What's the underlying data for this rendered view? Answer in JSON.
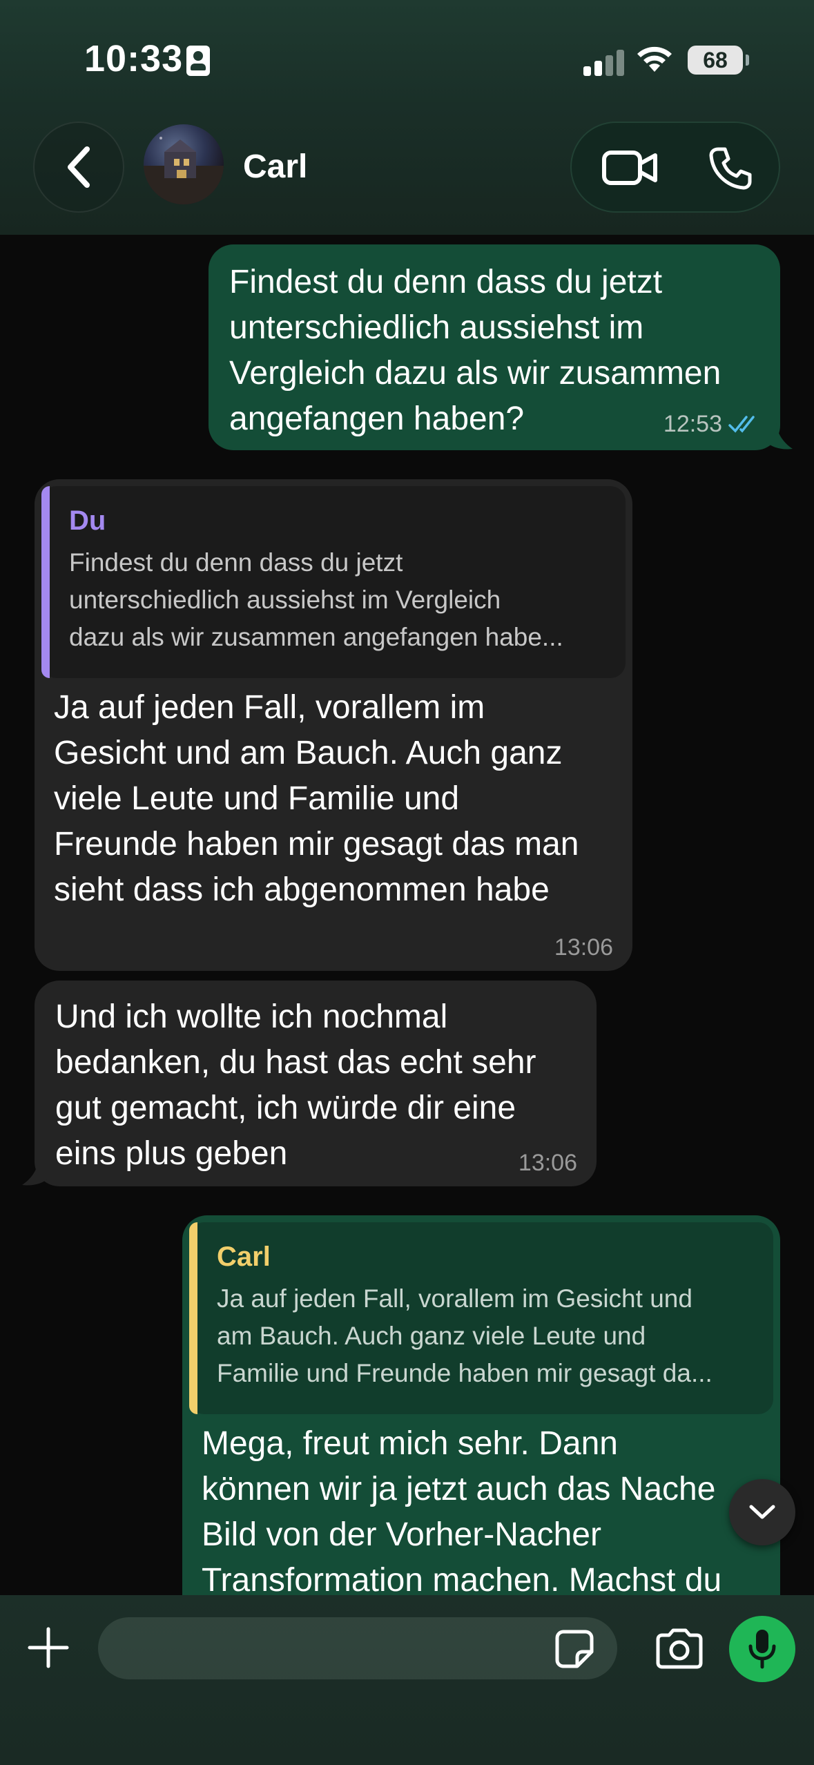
{
  "status_bar": {
    "time": "10:33",
    "battery": "68"
  },
  "header": {
    "contact_name": "Carl"
  },
  "messages": [
    {
      "direction": "outgoing",
      "lines": [
        "Findest du denn dass du jetzt",
        "unterschiedlich aussiehst im",
        "Vergleich dazu als wir zusammen",
        "angefangen haben?"
      ],
      "time": "12:53",
      "read": true
    },
    {
      "direction": "incoming",
      "quote": {
        "name": "Du",
        "lines": [
          "Findest du denn dass du jetzt",
          "unterschiedlich aussiehst im Vergleich",
          "dazu als wir zusammen angefangen habe..."
        ]
      },
      "lines": [
        "Ja auf jeden Fall, vorallem im",
        "Gesicht und am Bauch. Auch ganz",
        "viele Leute und Familie und",
        "Freunde haben mir gesagt das man",
        "sieht dass ich abgenommen habe"
      ],
      "time": "13:06"
    },
    {
      "direction": "incoming",
      "lines": [
        "Und ich wollte ich nochmal",
        "bedanken, du hast das echt sehr",
        "gut gemacht, ich würde dir eine",
        "eins plus geben"
      ],
      "time": "13:06"
    },
    {
      "direction": "outgoing",
      "quote": {
        "name": "Carl",
        "lines": [
          "Ja auf jeden Fall, vorallem im Gesicht und",
          "am Bauch. Auch ganz viele Leute und",
          "Familie und Freunde haben mir gesagt da..."
        ]
      },
      "lines": [
        "Mega, freut mich sehr. Dann",
        "können wir ja jetzt auch das Nache",
        "Bild von der Vorher-Nacher",
        "Transformation machen. Machst du"
      ]
    }
  ],
  "colors": {
    "outgoing_bubble": "#144d37",
    "incoming_bubble": "#242424",
    "quote_du_accent": "#a489f0",
    "quote_carl_accent": "#f2cf6b",
    "read_ticks": "#53bdeb",
    "mic_button": "#1fb656"
  },
  "composer": {
    "placeholder": ""
  }
}
